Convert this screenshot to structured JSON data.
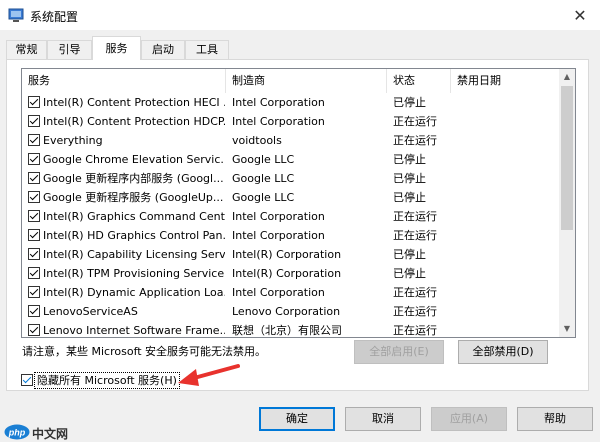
{
  "window": {
    "title": "系统配置"
  },
  "tabs": [
    {
      "label": "常规"
    },
    {
      "label": "引导"
    },
    {
      "label": "服务"
    },
    {
      "label": "启动"
    },
    {
      "label": "工具"
    }
  ],
  "active_tab": "服务",
  "columns": [
    "服务",
    "制造商",
    "状态",
    "禁用日期"
  ],
  "services": [
    {
      "checked": true,
      "name": "Intel(R) Content Protection HECI ...",
      "maker": "Intel Corporation",
      "status": "已停止"
    },
    {
      "checked": true,
      "name": "Intel(R) Content Protection HDCP...",
      "maker": "Intel Corporation",
      "status": "正在运行"
    },
    {
      "checked": true,
      "name": "Everything",
      "maker": "voidtools",
      "status": "正在运行"
    },
    {
      "checked": true,
      "name": "Google Chrome Elevation Servic...",
      "maker": "Google LLC",
      "status": "已停止"
    },
    {
      "checked": true,
      "name": "Google 更新程序内部服务 (Googl...",
      "maker": "Google LLC",
      "status": "已停止"
    },
    {
      "checked": true,
      "name": "Google 更新程序服务 (GoogleUp...",
      "maker": "Google LLC",
      "status": "已停止"
    },
    {
      "checked": true,
      "name": "Intel(R) Graphics Command Cent...",
      "maker": "Intel Corporation",
      "status": "正在运行"
    },
    {
      "checked": true,
      "name": "Intel(R) HD Graphics Control Pan...",
      "maker": "Intel Corporation",
      "status": "正在运行"
    },
    {
      "checked": true,
      "name": "Intel(R) Capability Licensing Servi...",
      "maker": "Intel(R) Corporation",
      "status": "已停止"
    },
    {
      "checked": true,
      "name": "Intel(R) TPM Provisioning Service",
      "maker": "Intel(R) Corporation",
      "status": "已停止"
    },
    {
      "checked": true,
      "name": "Intel(R) Dynamic Application Loa...",
      "maker": "Intel Corporation",
      "status": "正在运行"
    },
    {
      "checked": true,
      "name": "LenovoServiceAS",
      "maker": "Lenovo Corporation",
      "status": "正在运行"
    },
    {
      "checked": true,
      "name": "Lenovo Internet Software Frame...",
      "maker": "联想（北京）有限公司",
      "status": "正在运行"
    }
  ],
  "note": "请注意，某些 Microsoft 安全服务可能无法禁用。",
  "buttons": {
    "enable_all": "全部启用(E)",
    "disable_all": "全部禁用(D)",
    "ok": "确定",
    "cancel": "取消",
    "apply": "应用(A)",
    "help": "帮助"
  },
  "hide_ms": {
    "checked": true,
    "label": "隐藏所有 Microsoft 服务(H)"
  },
  "watermark": {
    "text": "中文网"
  },
  "colors": {
    "accent": "#0078d7",
    "arrow": "#e8322d",
    "watermark_logo": "#1a7fd4"
  }
}
